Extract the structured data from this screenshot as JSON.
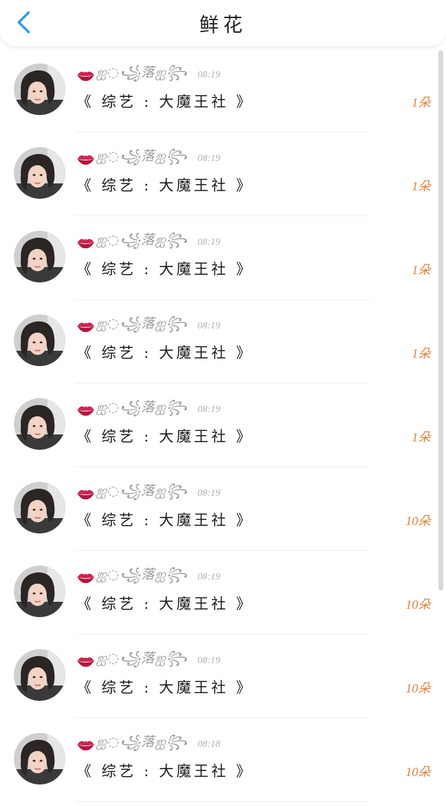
{
  "header": {
    "title": "鲜花",
    "back_icon": "chevron-left-icon",
    "accent_color": "#2a9df4"
  },
  "colors": {
    "count_color": "#e3823a",
    "lips_color": "#c2185b"
  },
  "items": [
    {
      "nick": "ஐ◌꧁落ஐ꧂",
      "time": "08:19",
      "title": "《 综艺 : 大魔王社 》",
      "count": "1朵"
    },
    {
      "nick": "ஐ◌꧁落ஐ꧂",
      "time": "08:19",
      "title": "《 综艺 : 大魔王社 》",
      "count": "1朵"
    },
    {
      "nick": "ஐ◌꧁落ஐ꧂",
      "time": "08:19",
      "title": "《 综艺 : 大魔王社 》",
      "count": "1朵"
    },
    {
      "nick": "ஐ◌꧁落ஐ꧂",
      "time": "08:19",
      "title": "《 综艺 : 大魔王社 》",
      "count": "1朵"
    },
    {
      "nick": "ஐ◌꧁落ஐ꧂",
      "time": "08:19",
      "title": "《 综艺 : 大魔王社 》",
      "count": "1朵"
    },
    {
      "nick": "ஐ◌꧁落ஐ꧂",
      "time": "08:19",
      "title": "《 综艺 : 大魔王社 》",
      "count": "10朵"
    },
    {
      "nick": "ஐ◌꧁落ஐ꧂",
      "time": "08:19",
      "title": "《 综艺 : 大魔王社 》",
      "count": "10朵"
    },
    {
      "nick": "ஐ◌꧁落ஐ꧂",
      "time": "08:19",
      "title": "《 综艺 : 大魔王社 》",
      "count": "10朵"
    },
    {
      "nick": "ஐ◌꧁落ஐ꧂",
      "time": "08:18",
      "title": "《 综艺 : 大魔王社 》",
      "count": "10朵"
    }
  ]
}
